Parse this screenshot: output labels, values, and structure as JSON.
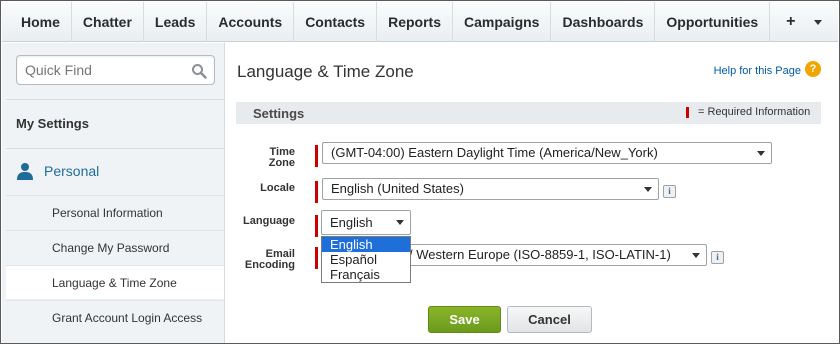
{
  "nav": {
    "tabs": [
      "Home",
      "Chatter",
      "Leads",
      "Accounts",
      "Contacts",
      "Reports",
      "Campaigns",
      "Dashboards",
      "Opportunities"
    ],
    "plus_label": "+",
    "more_icon": "chevron-down-icon"
  },
  "sidebar": {
    "quick_find_placeholder": "Quick Find",
    "my_settings": "My Settings",
    "personal": "Personal",
    "items": [
      "Personal Information",
      "Change My Password",
      "Language & Time Zone",
      "Grant Account Login Access"
    ],
    "active_item": "Language & Time Zone"
  },
  "main": {
    "title": "Language & Time Zone",
    "help_link": "Help for this Page",
    "help_icon_glyph": "?",
    "section_title": "Settings",
    "required_info": "= Required Information",
    "fields": {
      "timezone": {
        "label_line1": "Time",
        "label_line2": "Zone",
        "value": "(GMT-04:00) Eastern Daylight Time (America/New_York)"
      },
      "locale": {
        "label": "Locale",
        "value": "English (United States)"
      },
      "language": {
        "label": "Language",
        "value": "English",
        "options": [
          "English",
          "Español",
          "Français"
        ]
      },
      "email_encoding": {
        "label_line1": "Email",
        "label_line2": "Encoding",
        "value": "/ Western Europe (ISO-8859-1, ISO-LATIN-1)"
      }
    },
    "info_glyph": "i",
    "save_label": "Save",
    "cancel_label": "Cancel"
  },
  "colors": {
    "accent_link": "#015ba7",
    "required": "#cc0000",
    "save_button": "#7aa823",
    "selected_option": "#1e6fd9"
  }
}
